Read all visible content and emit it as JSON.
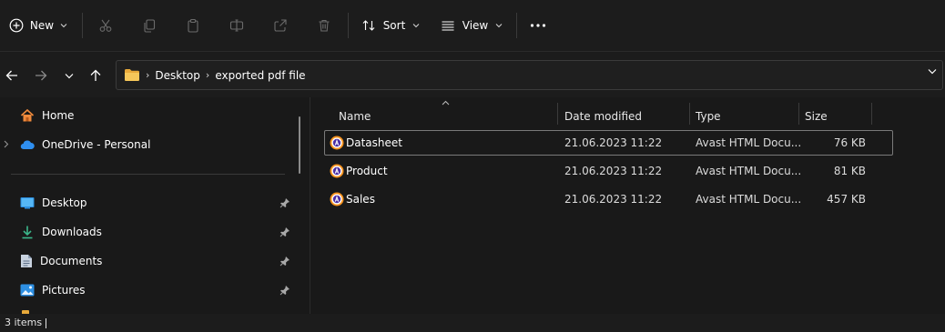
{
  "toolbar": {
    "new_label": "New",
    "sort_label": "Sort",
    "view_label": "View"
  },
  "breadcrumb": [
    "Desktop",
    "exported pdf file"
  ],
  "sidebar": {
    "top_items": [
      {
        "label": "Home",
        "icon": "home-icon"
      },
      {
        "label": "OneDrive - Personal",
        "icon": "onedrive-icon"
      }
    ],
    "quick_access": [
      {
        "label": "Desktop",
        "icon": "desktop-folder-icon",
        "pinned": true
      },
      {
        "label": "Downloads",
        "icon": "downloads-folder-icon",
        "pinned": true
      },
      {
        "label": "Documents",
        "icon": "documents-folder-icon",
        "pinned": true
      },
      {
        "label": "Pictures",
        "icon": "pictures-folder-icon",
        "pinned": true
      }
    ]
  },
  "columns": {
    "name": "Name",
    "date": "Date modified",
    "type": "Type",
    "size": "Size"
  },
  "files": [
    {
      "name": "Datasheet",
      "date": "21.06.2023 11:22",
      "type": "Avast HTML Docu...",
      "size": "76 KB",
      "icon": "avast-html-file-icon",
      "focused": true
    },
    {
      "name": "Product",
      "date": "21.06.2023 11:22",
      "type": "Avast HTML Docu...",
      "size": "81 KB",
      "icon": "avast-html-file-icon",
      "focused": false
    },
    {
      "name": "Sales",
      "date": "21.06.2023 11:22",
      "type": "Avast HTML Docu...",
      "size": "457 KB",
      "icon": "avast-html-file-icon",
      "focused": false
    }
  ],
  "status": {
    "item_count": "3 items"
  },
  "colors": {
    "background": "#191919",
    "folder_yellow": "#f2c14e",
    "avast_orange": "#f7931e",
    "avast_purple": "#4b2fa5"
  }
}
